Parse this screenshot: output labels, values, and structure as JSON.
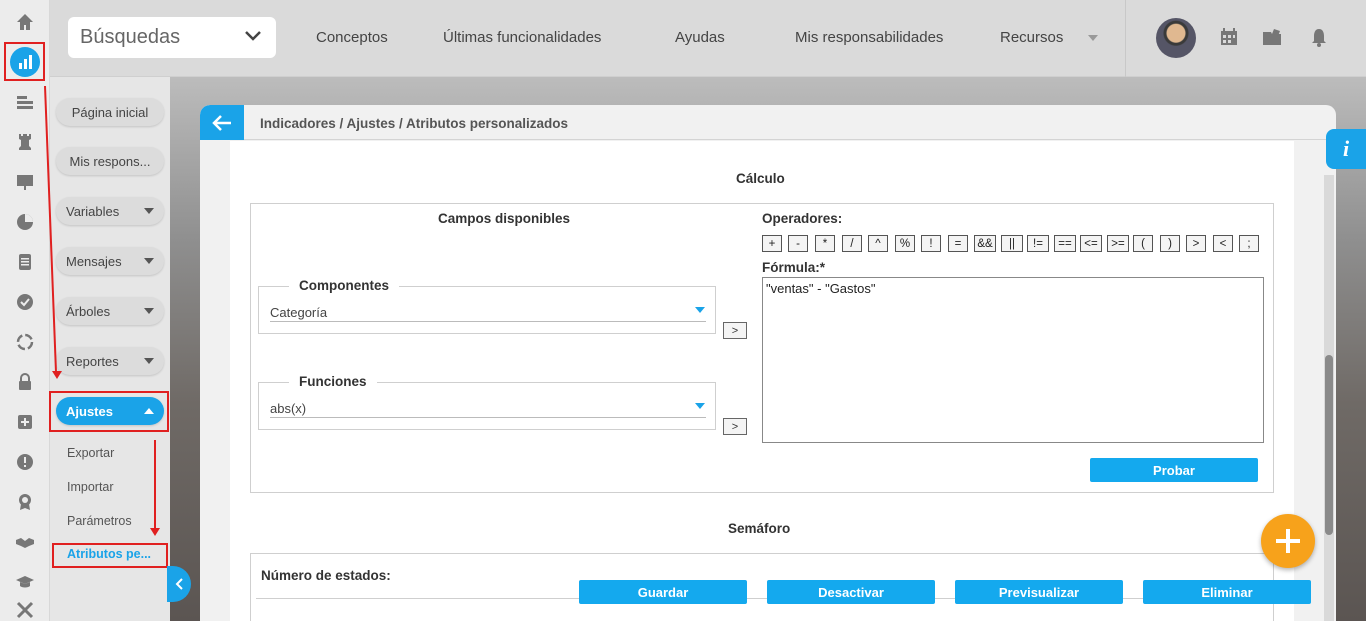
{
  "search": {
    "placeholder": "Búsquedas"
  },
  "nav": [
    {
      "label": "Conceptos"
    },
    {
      "label": "Últimas funcionalidades"
    },
    {
      "label": "Ayudas"
    },
    {
      "label": "Mis responsabilidades"
    },
    {
      "label": "Recursos"
    }
  ],
  "sidebar": {
    "items": [
      {
        "label": "Página inicial"
      },
      {
        "label": "Mis respons..."
      },
      {
        "label": "Variables"
      },
      {
        "label": "Mensajes"
      },
      {
        "label": "Árboles"
      },
      {
        "label": "Reportes"
      },
      {
        "label": "Ajustes"
      }
    ],
    "submenu": [
      {
        "label": "Exportar"
      },
      {
        "label": "Importar"
      },
      {
        "label": "Parámetros"
      },
      {
        "label": "Atributos pe..."
      }
    ]
  },
  "breadcrumb": "Indicadores / Ajustes / Atributos personalizados",
  "calculo": {
    "title": "Cálculo",
    "campos_title": "Campos disponibles",
    "componentes": {
      "legend": "Componentes",
      "value": "Categoría",
      "add": ">"
    },
    "funciones": {
      "legend": "Funciones",
      "value": "abs(x)",
      "add": ">"
    },
    "operadores_label": "Operadores:",
    "operators": [
      "+",
      "-",
      "*",
      "/",
      "^",
      "%",
      "!",
      "=",
      "&&",
      "||",
      "!=",
      "==",
      "<=",
      ">=",
      "(",
      ")",
      ">",
      "<",
      ";"
    ],
    "formula_label": "Fórmula:*",
    "formula_value": "\"ventas\" - \"Gastos\"",
    "probar": "Probar"
  },
  "semaforo": {
    "title": "Semáforo",
    "numero_label": "Número de estados:"
  },
  "actions": {
    "guardar": "Guardar",
    "desactivar": "Desactivar",
    "previsualizar": "Previsualizar",
    "eliminar": "Eliminar"
  },
  "info": "i",
  "colors": {
    "accent": "#1aa3e8",
    "fab": "#f7a21b",
    "highlight": "#e02020"
  }
}
